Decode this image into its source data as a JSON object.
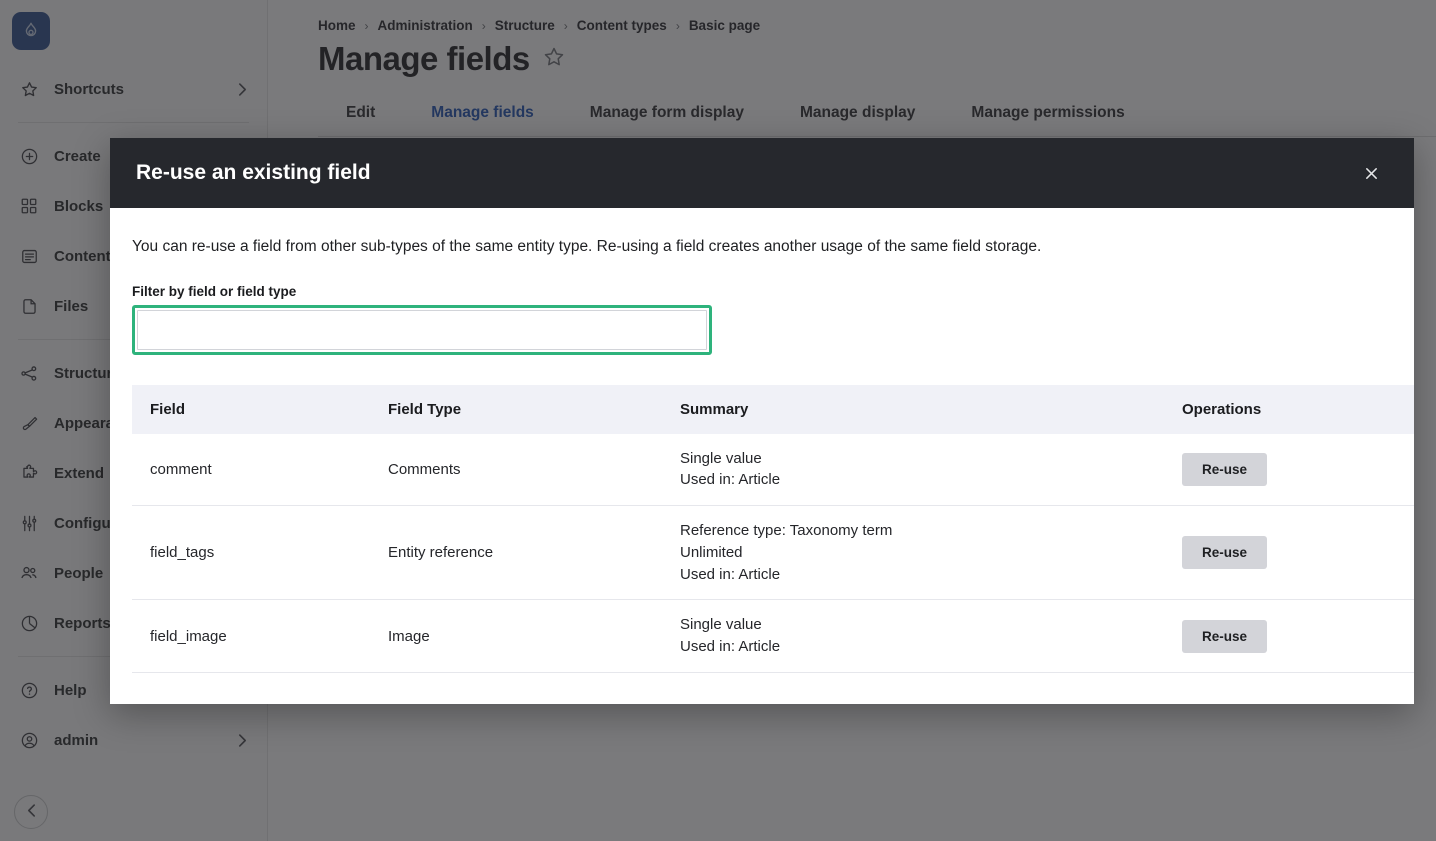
{
  "sidebar": {
    "logo_icon": "drupal-drop-icon",
    "items": [
      {
        "label": "Shortcuts",
        "icon": "star-icon",
        "chevron": "›",
        "has_chevron": true
      },
      {
        "label": "Create",
        "icon": "plus-circle-icon",
        "has_chevron": false
      },
      {
        "label": "Blocks",
        "icon": "blocks-grid-icon",
        "has_chevron": false
      },
      {
        "label": "Content",
        "icon": "content-document-icon",
        "has_chevron": false
      },
      {
        "label": "Files",
        "icon": "files-page-icon",
        "has_chevron": false
      },
      {
        "label": "Structure",
        "icon": "structure-nodes-icon",
        "has_chevron": false
      },
      {
        "label": "Appearance",
        "icon": "paintbrush-icon",
        "has_chevron": false
      },
      {
        "label": "Extend",
        "icon": "puzzle-piece-icon",
        "has_chevron": false
      },
      {
        "label": "Configuration",
        "icon": "sliders-icon",
        "has_chevron": false
      },
      {
        "label": "People",
        "icon": "people-icon",
        "has_chevron": false
      },
      {
        "label": "Reports",
        "icon": "pie-chart-icon",
        "has_chevron": false
      },
      {
        "label": "Help",
        "icon": "question-circle-icon",
        "has_chevron": false
      },
      {
        "label": "admin",
        "icon": "user-circle-icon",
        "chevron": "›",
        "has_chevron": true
      }
    ],
    "collapse_icon": "chevron-left-icon"
  },
  "breadcrumb": {
    "items": [
      "Home",
      "Administration",
      "Structure",
      "Content types",
      "Basic page"
    ],
    "separator": "›"
  },
  "header": {
    "title": "Manage fields",
    "star_icon": "star-outline-icon"
  },
  "tabs": [
    {
      "label": "Edit",
      "active": false
    },
    {
      "label": "Manage fields",
      "active": true
    },
    {
      "label": "Manage form display",
      "active": false
    },
    {
      "label": "Manage display",
      "active": false
    },
    {
      "label": "Manage permissions",
      "active": false
    }
  ],
  "modal": {
    "title": "Re-use an existing field",
    "close_icon": "close-x-icon",
    "description": "You can re-use a field from other sub-types of the same entity type. Re-using a field creates another usage of the same field storage.",
    "filter": {
      "label": "Filter by field or field type",
      "value": "",
      "placeholder": ""
    },
    "table": {
      "columns": [
        "Field",
        "Field Type",
        "Summary",
        "Operations"
      ],
      "rows": [
        {
          "field": "comment",
          "field_type": "Comments",
          "summary": [
            "Single value",
            "Used in: Article"
          ],
          "operation": "Re-use"
        },
        {
          "field": "field_tags",
          "field_type": "Entity reference",
          "summary": [
            "Reference type: Taxonomy term",
            "Unlimited",
            "Used in: Article"
          ],
          "operation": "Re-use"
        },
        {
          "field": "field_image",
          "field_type": "Image",
          "summary": [
            "Single value",
            "Used in: Article"
          ],
          "operation": "Re-use"
        }
      ]
    }
  },
  "colors": {
    "brand_blue": "#2b4d8c",
    "active_tab": "#1e52b5",
    "focus_green": "#2eb37c",
    "modal_header": "#26282d",
    "table_header_bg": "#f0f1f7",
    "button_bg": "#d3d4d9"
  }
}
